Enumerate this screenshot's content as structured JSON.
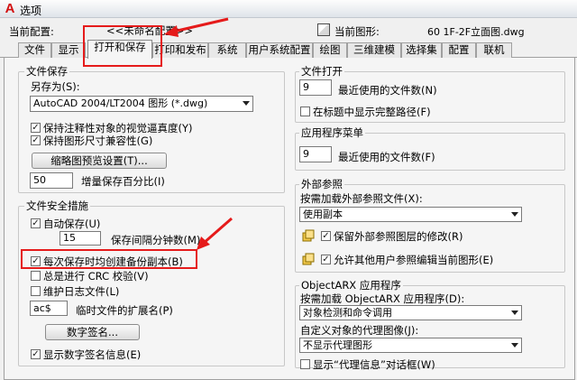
{
  "window": {
    "title": "选项",
    "logo": "A"
  },
  "header": {
    "current_profile_label": "当前配置:",
    "current_profile_value": "<<未命名配置>>",
    "current_drawing_label": "当前图形:",
    "current_drawing_value": "60 1F-2F立面图.dwg"
  },
  "tabs": [
    "文件",
    "显示",
    "打开和保存",
    "打印和发布",
    "系统",
    "用户系统配置",
    "绘图",
    "三维建模",
    "选择集",
    "配置",
    "联机"
  ],
  "file_save": {
    "legend": "文件保存",
    "save_as_label": "另存为(S):",
    "save_as_value": "AutoCAD 2004/LT2004 图形 (*.dwg)",
    "keep_annotative": "保持注释性对象的视觉逼真度(Y)",
    "keep_drawing_size": "保持图形尺寸兼容性(G)",
    "thumbnail_button": "缩略图预览设置(T)...",
    "incremental_value": "50",
    "incremental_label": "增量保存百分比(I)"
  },
  "safety": {
    "legend": "文件安全措施",
    "autosave": "自动保存(U)",
    "minutes_value": "15",
    "minutes_label": "保存间隔分钟数(M)",
    "backup_copy": "每次保存时均创建备份副本(B)",
    "crc_check": "总是进行 CRC 校验(V)",
    "log_file": "维护日志文件(L)",
    "ext_value": "ac$",
    "ext_label": "临时文件的扩展名(P)",
    "digital_sig_button": "数字签名...",
    "show_sig_info": "显示数字签名信息(E)"
  },
  "file_open": {
    "legend": "文件打开",
    "recent_value": "9",
    "recent_label": "最近使用的文件数(N)",
    "full_path": "在标题中显示完整路径(F)"
  },
  "app_menu": {
    "legend": "应用程序菜单",
    "recent_value": "9",
    "recent_label": "最近使用的文件数(F)"
  },
  "xref": {
    "legend": "外部参照",
    "demand_load_label": "按需加载外部参照文件(X):",
    "demand_load_value": "使用副本",
    "retain_changes": "保留外部参照图层的修改(R)",
    "allow_edit": "允许其他用户参照编辑当前图形(E)"
  },
  "arx": {
    "legend": "ObjectARX 应用程序",
    "demand_load_label": "按需加载 ObjectARX 应用程序(D):",
    "demand_load_value": "对象检测和命令调用",
    "proxy_label": "自定义对象的代理图像(J):",
    "proxy_value": "不显示代理图形",
    "show_proxy_dialog": "显示“代理信息”对话框(W)"
  },
  "colors": {
    "annotation": "#e51b1b"
  }
}
